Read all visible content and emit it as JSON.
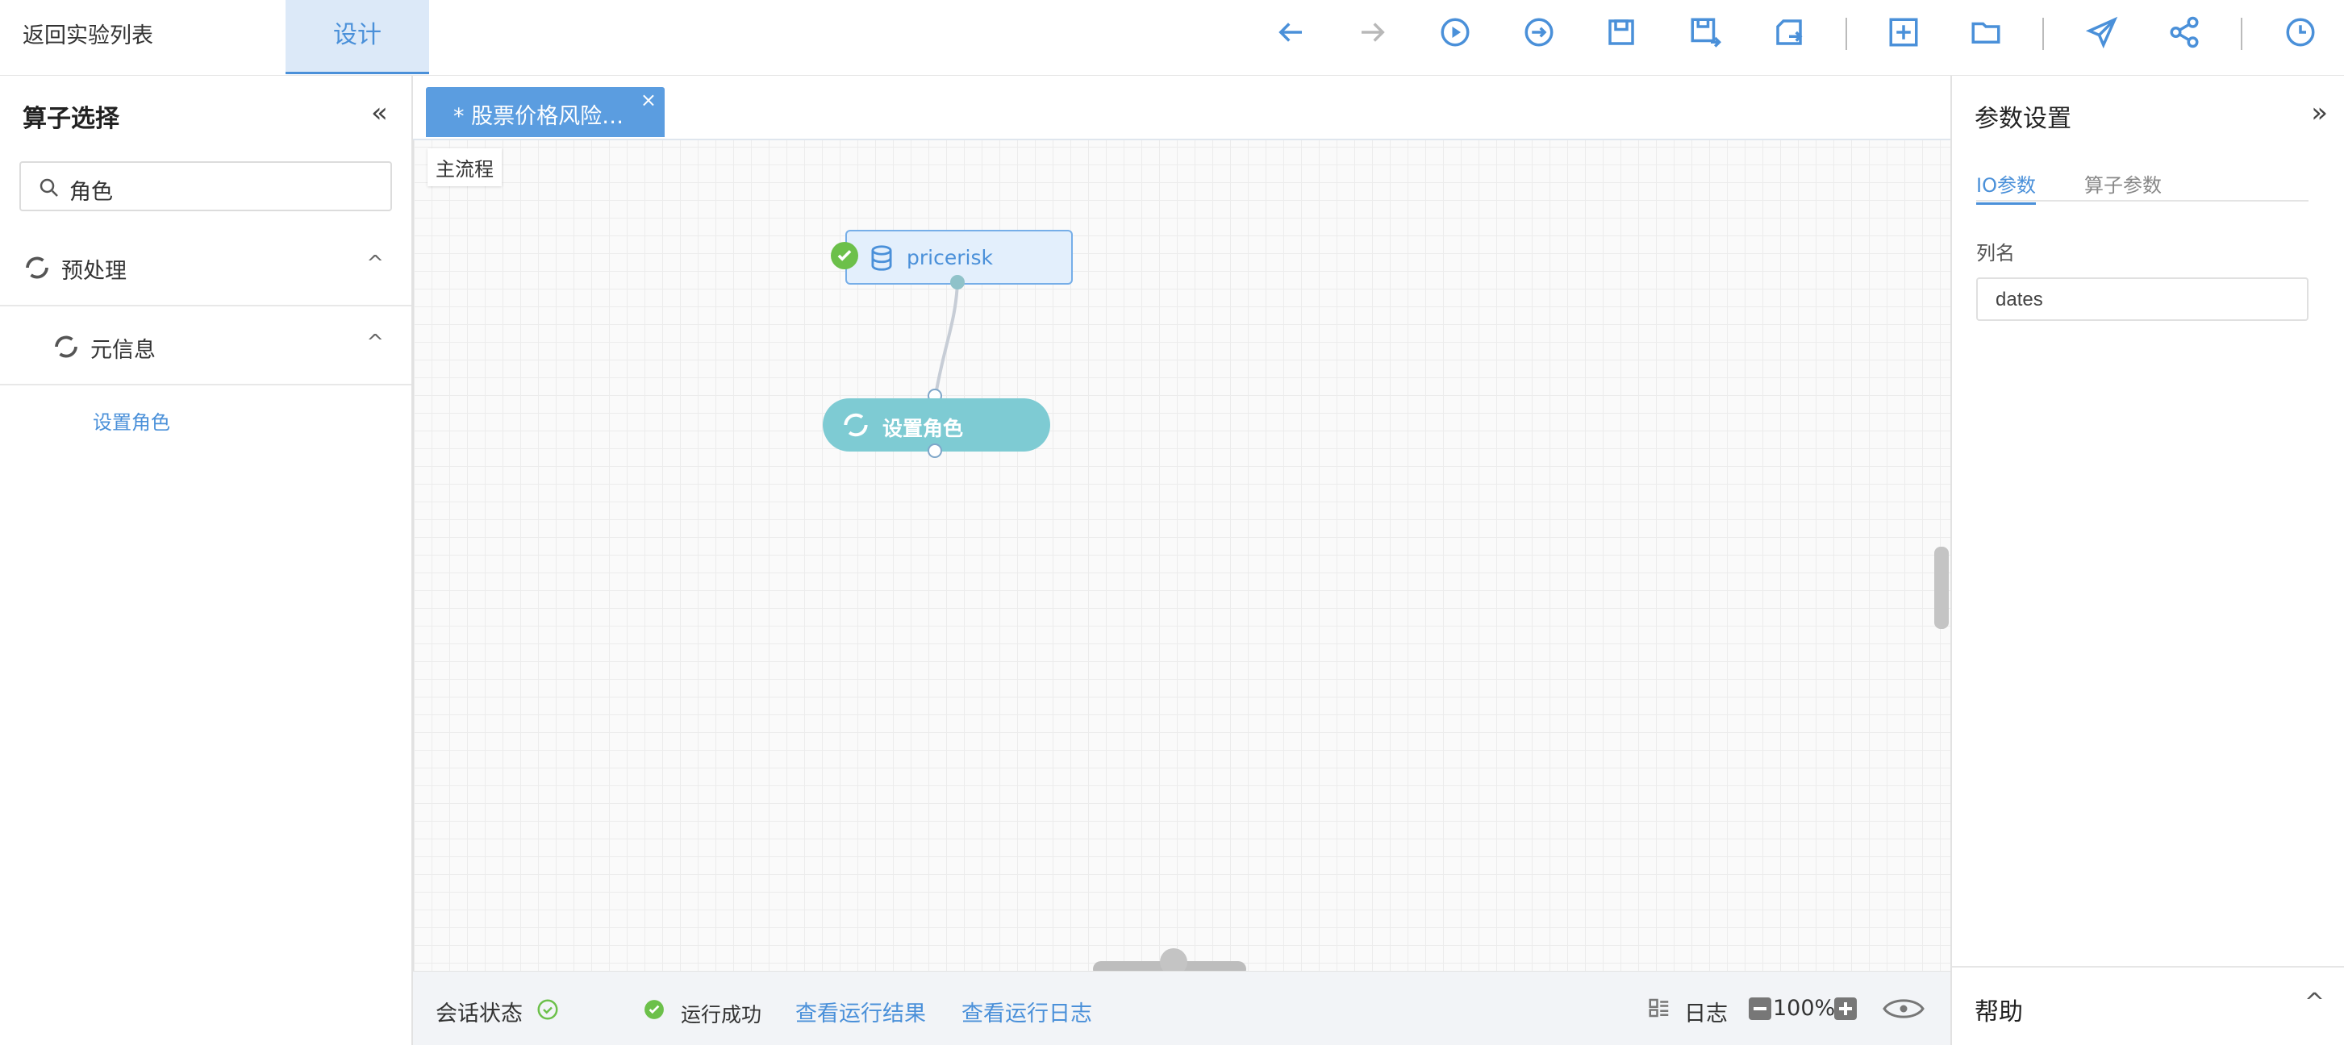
{
  "topbar": {
    "back_label": "返回实验列表",
    "design_tab": "设计",
    "toolbar_icons": [
      "undo-icon",
      "redo-icon",
      "run-icon",
      "run-from-here-icon",
      "save-icon",
      "save-as-icon",
      "export-icon",
      "new-icon",
      "open-folder-icon",
      "publish-icon",
      "share-icon",
      "history-icon"
    ]
  },
  "left_panel": {
    "title": "算子选择",
    "collapse_glyph": "«",
    "search_value": "角色",
    "tree": [
      {
        "label": "预处理",
        "chevron": "^"
      },
      {
        "label": "元信息",
        "chevron": "^"
      }
    ],
    "leaf": "设置角色"
  },
  "canvas": {
    "flow_tab": "* 股票价格风险…",
    "flow_tab_close": "×",
    "main_flow": "主流程",
    "source_node": "pricerisk",
    "operator_node": "设置角色"
  },
  "statusbar": {
    "session_label": "会话状态",
    "run_status": "运行成功",
    "view_results": "查看运行结果",
    "view_logs": "查看运行日志",
    "log_label": "日志",
    "zoom": "100%"
  },
  "right_panel": {
    "title": "参数设置",
    "collapse_glyph": "»",
    "tabs": [
      "IO参数",
      "算子参数"
    ],
    "field_label": "列名",
    "field_value": "dates",
    "help_label": "帮助",
    "help_chevron": "^"
  },
  "colors": {
    "accent": "#4a90d9",
    "operator_node": "#7ecbd3",
    "success": "#6cc04a"
  }
}
